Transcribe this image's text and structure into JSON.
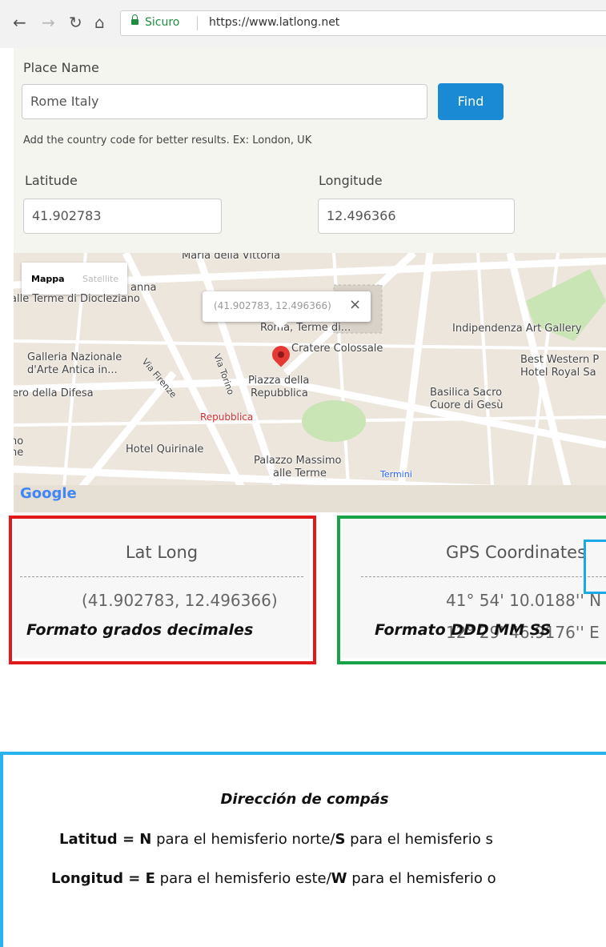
{
  "browser": {
    "secure_label": "Sicuro",
    "url": "https://www.latlong.net"
  },
  "form": {
    "place_label": "Place Name",
    "place_value": "Rome Italy",
    "find_label": "Find",
    "hint": "Add the country code for better results. Ex: London, UK",
    "lat_label": "Latitude",
    "lat_value": "41.902783",
    "lng_label": "Longitude",
    "lng_value": "12.496366"
  },
  "map": {
    "type_map": "Mappa",
    "type_sat": "Satellite",
    "popup_text": "(41.902783, 12.496366)",
    "popup_close": "×",
    "logo": "Google",
    "labels": {
      "maria": "Maria della Vittoria",
      "terme": "anna",
      "terme2": "alle Terme di Diocleziano",
      "roma": "Roma, Terme di...",
      "cratere": "Cratere Colossale",
      "indip": "Indipendenza Art Gallery",
      "galleria1": "Galleria Nazionale",
      "galleria2": "d'Arte Antica in...",
      "bw1": "Best Western P",
      "bw2": "Hotel Royal Sa",
      "firenze": "Via Firenze",
      "torino": "Via Torino",
      "piazza1": "Piazza della",
      "piazza2": "Repubblica",
      "difesa": "ero della Difesa",
      "basilica1": "Basilica Sacro",
      "basilica2": "Cuore di Gesù",
      "repubblica": "Repubblica",
      "hotel": "Hotel Quirinale",
      "massimo1": "Palazzo Massimo",
      "massimo2": "alle Terme",
      "termini": "Termini",
      "no": "no",
      "ne": "ne"
    }
  },
  "results": {
    "latlong_title": "Lat Long",
    "latlong_value": "(41.902783, 12.496366)",
    "gps_title": "GPS Coordinates",
    "gps_lat": "41° 54' 10.0188'' N",
    "gps_lng": "12° 29' 46.9176'' E"
  },
  "captions": {
    "decimal": "Formato grados decimales",
    "dms": "Formato DDD MM SS"
  },
  "explain": {
    "title": "Dirección de compás",
    "lat_bold": "Latitud = N",
    "lat_mid": " para el hemisferio norte/",
    "lat_bold2": "S",
    "lat_end": " para el hemisferio s",
    "lng_bold": "Longitud = E",
    "lng_mid": " para el hemisferio este/",
    "lng_bold2": "W",
    "lng_end": " para el hemisferio o"
  }
}
